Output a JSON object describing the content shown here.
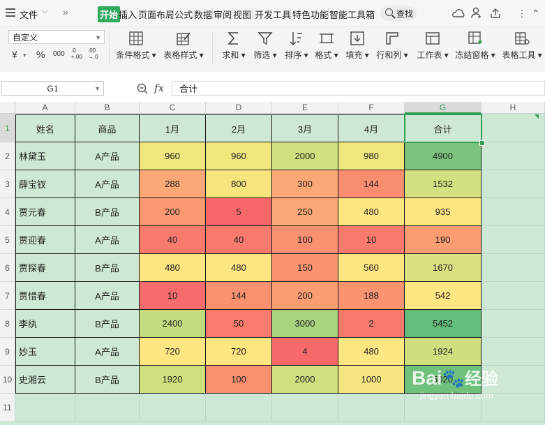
{
  "menubar": {
    "file_label": "文件",
    "tabs": [
      "开始",
      "插入",
      "页面布局",
      "公式",
      "数据",
      "审阅",
      "视图",
      "开发工具",
      "特色功能",
      "智能工具箱"
    ],
    "search_label": "查找"
  },
  "ribbon": {
    "number_format": "自定义",
    "currency_symbol": "¥",
    "percent_symbol": "%",
    "thousands_symbol": "000",
    "inc_decimal": ".0\n+.00",
    "dec_decimal": ".00\n→.0",
    "buttons": [
      "条件格式",
      "表格样式",
      "求和",
      "筛选",
      "排序",
      "格式",
      "填充",
      "行和列",
      "工作表",
      "冻结窗格",
      "表格工具"
    ]
  },
  "formula_bar": {
    "name_box": "G1",
    "fx": "fx",
    "content": "合计"
  },
  "grid": {
    "columns": [
      "A",
      "B",
      "C",
      "D",
      "E",
      "F",
      "G",
      "H"
    ],
    "rows": [
      "1",
      "2",
      "3",
      "4",
      "5",
      "6",
      "7",
      "8",
      "9",
      "10",
      "11"
    ],
    "header": [
      "姓名",
      "商品",
      "1月",
      "2月",
      "3月",
      "4月",
      "合计"
    ],
    "data": [
      [
        "林黛玉",
        "A产品",
        "960",
        "960",
        "2000",
        "980",
        "4900"
      ],
      [
        "薛宝钗",
        "A产品",
        "288",
        "800",
        "300",
        "144",
        "1532"
      ],
      [
        "贾元春",
        "B产品",
        "200",
        "5",
        "250",
        "480",
        "935"
      ],
      [
        "贾迎春",
        "A产品",
        "40",
        "40",
        "100",
        "10",
        "190"
      ],
      [
        "贾探春",
        "B产品",
        "480",
        "480",
        "150",
        "560",
        "1670"
      ],
      [
        "贾惜春",
        "A产品",
        "10",
        "144",
        "200",
        "188",
        "542"
      ],
      [
        "李纨",
        "B产品",
        "2400",
        "50",
        "3000",
        "2",
        "5452"
      ],
      [
        "妙玉",
        "A产品",
        "720",
        "720",
        "4",
        "480",
        "1924"
      ],
      [
        "史湘云",
        "B产品",
        "1920",
        "100",
        "2000",
        "1000",
        "5020"
      ]
    ],
    "colors": [
      [
        "#f0e67e",
        "#f0e67e",
        "#cfe07f",
        "#f0e67e",
        "#7ec47c"
      ],
      [
        "#fba876",
        "#f8e57e",
        "#fba876",
        "#f98d70",
        "#d4e07f"
      ],
      [
        "#fb9a72",
        "#f7686a",
        "#fba876",
        "#fee683",
        "#fee683"
      ],
      [
        "#f87a6d",
        "#f87a6d",
        "#f99070",
        "#f87a6d",
        "#fb9c72"
      ],
      [
        "#fee683",
        "#fee683",
        "#fa9470",
        "#fee683",
        "#dbe181"
      ],
      [
        "#f66b6b",
        "#f99070",
        "#fb9c72",
        "#fa9470",
        "#fee683"
      ],
      [
        "#c4dc80",
        "#f87b6e",
        "#a9d27f",
        "#f87a6d",
        "#63be7b"
      ],
      [
        "#fee683",
        "#fee683",
        "#f6696b",
        "#fee683",
        "#cfdf80"
      ],
      [
        "#cfe07f",
        "#f99070",
        "#cfe07f",
        "#f7e482",
        "#6fc17c"
      ]
    ],
    "label_fill": "#cde8d4",
    "selected_cell": "G1"
  },
  "watermark": {
    "brand": "Bai",
    "brand2": "经验",
    "url": "jingyan.baidu.com"
  }
}
